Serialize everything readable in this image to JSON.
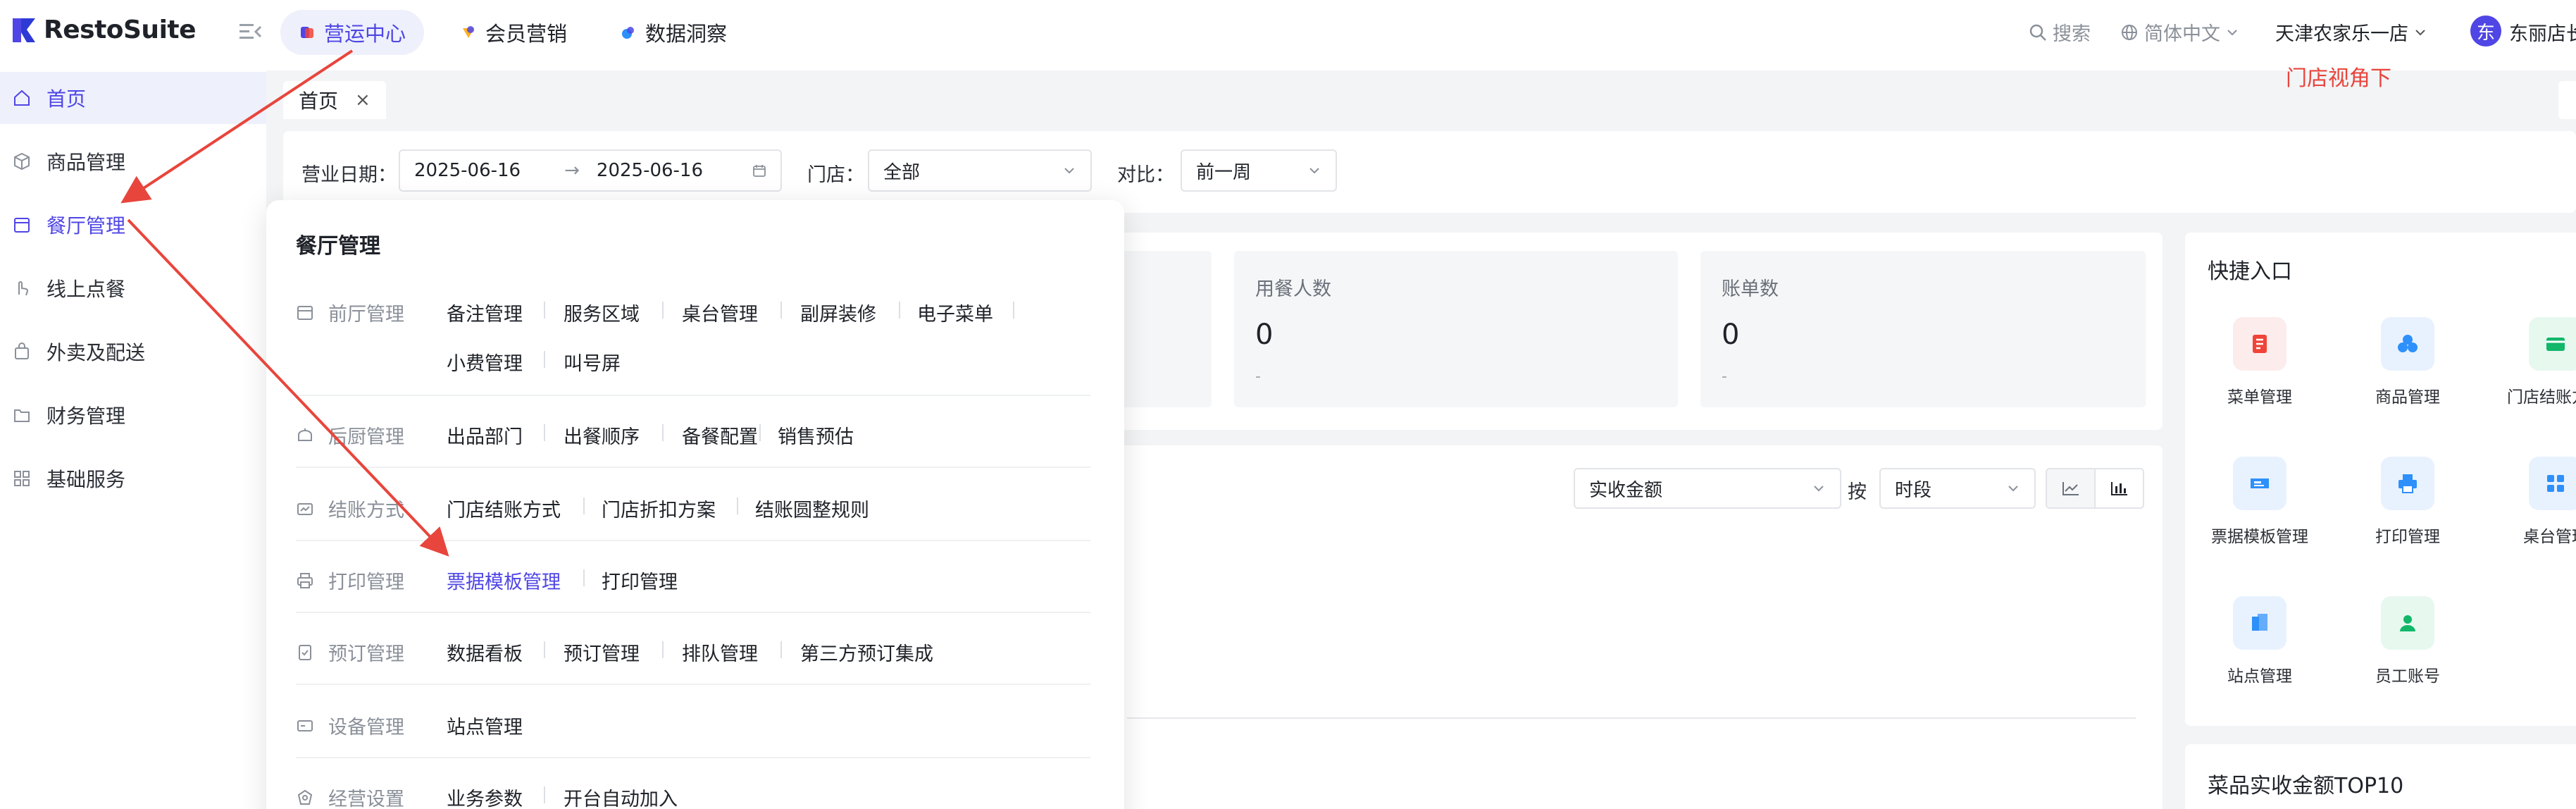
{
  "header": {
    "brand": "RestoSuite",
    "nav_tabs": [
      {
        "label": "营运中心",
        "active": true
      },
      {
        "label": "会员营销",
        "active": false
      },
      {
        "label": "数据洞察",
        "active": false
      }
    ],
    "search_label": "搜索",
    "language": "简体中文",
    "store_name": "天津农家乐一店",
    "avatar_initial": "东",
    "user_name": "东丽店长",
    "annotation": "门店视角下"
  },
  "sidebar": {
    "items": [
      {
        "label": "首页",
        "icon": "home-icon",
        "active": true
      },
      {
        "label": "商品管理",
        "icon": "box-icon",
        "active": false
      },
      {
        "label": "餐厅管理",
        "icon": "store-icon",
        "active": false,
        "highlight": true
      },
      {
        "label": "线上点餐",
        "icon": "hand-icon",
        "active": false
      },
      {
        "label": "外卖及配送",
        "icon": "bag-icon",
        "active": false
      },
      {
        "label": "财务管理",
        "icon": "folder-icon",
        "active": false
      },
      {
        "label": "基础服务",
        "icon": "grid-icon",
        "active": false
      }
    ]
  },
  "tabs": {
    "home": "首页",
    "close": "×"
  },
  "filters": {
    "date_label": "营业日期：",
    "date_start": "2025-06-16",
    "date_sep": "→",
    "date_end": "2025-06-16",
    "store_label": "门店：",
    "store_value": "全部",
    "compare_label": "对比：",
    "compare_value": "前一周"
  },
  "stats": [
    {
      "label": "用餐人数",
      "value": "0",
      "sub": "-"
    },
    {
      "label": "账单数",
      "value": "0",
      "sub": "-"
    }
  ],
  "chart_controls": {
    "metric": "实收金额",
    "by_label": "按",
    "dimension": "时段"
  },
  "quick_entry": {
    "title": "快捷入口",
    "items": [
      {
        "label": "菜单管理",
        "icon": "menu-book-icon",
        "color": "#f04438",
        "bg": "#fdecec"
      },
      {
        "label": "商品管理",
        "icon": "cube-icon",
        "color": "#2e90fa",
        "bg": "#e8f2fe"
      },
      {
        "label": "门店结账方式",
        "icon": "card-icon",
        "color": "#12b76a",
        "bg": "#e7f8ef"
      },
      {
        "label": "票据模板管理",
        "icon": "ticket-icon",
        "color": "#2e90fa",
        "bg": "#e8f2fe"
      },
      {
        "label": "打印管理",
        "icon": "printer-icon",
        "color": "#2e90fa",
        "bg": "#e8f2fe"
      },
      {
        "label": "桌台管理",
        "icon": "tables-icon",
        "color": "#2e90fa",
        "bg": "#e8f2fe"
      },
      {
        "label": "站点管理",
        "icon": "station-icon",
        "color": "#2e90fa",
        "bg": "#e8f2fe"
      },
      {
        "label": "员工账号",
        "icon": "user-icon",
        "color": "#12b76a",
        "bg": "#e7f8ef"
      }
    ]
  },
  "top10": {
    "title": "菜品实收金额TOP10"
  },
  "popover": {
    "title": "餐厅管理",
    "groups": [
      {
        "name": "前厅管理",
        "icon": "front-hall-icon",
        "links": [
          "备注管理",
          "服务区域",
          "桌台管理",
          "副屏装修",
          "电子菜单",
          "小费管理",
          "叫号屏"
        ]
      },
      {
        "name": "后厨管理",
        "icon": "kitchen-icon",
        "links": [
          "出品部门",
          "出餐顺序",
          "备餐配置",
          "销售预估"
        ]
      },
      {
        "name": "结账方式",
        "icon": "checkout-icon",
        "links": [
          "门店结账方式",
          "门店折扣方案",
          "结账圆整规则"
        ]
      },
      {
        "name": "打印管理",
        "icon": "print-icon",
        "links": [
          "票据模板管理",
          "打印管理"
        ],
        "active_link": "票据模板管理"
      },
      {
        "name": "预订管理",
        "icon": "reserve-icon",
        "links": [
          "数据看板",
          "预订管理",
          "排队管理",
          "第三方预订集成"
        ]
      },
      {
        "name": "设备管理",
        "icon": "device-icon",
        "links": [
          "站点管理"
        ]
      },
      {
        "name": "经营设置",
        "icon": "settings-icon",
        "links": [
          "业务参数",
          "开台自动加入"
        ]
      }
    ]
  }
}
